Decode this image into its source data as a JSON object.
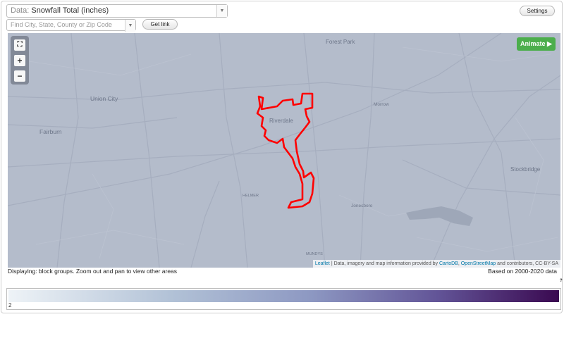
{
  "controls": {
    "data_prefix": "Data:",
    "data_value": "Snowfall Total (inches)",
    "find_placeholder": "Find City, State, County or Zip Code",
    "get_link_label": "Get link",
    "settings_label": "Settings",
    "animate_label": "Animate ▶"
  },
  "map": {
    "zoom_in": "+",
    "zoom_out": "−",
    "labels": {
      "forest_park": "Forest Park",
      "union_city": "Union City",
      "fairburn": "Fairburn",
      "riverdale": "Riverdale",
      "morrow": "Morrow",
      "stockbridge": "Stockbridge",
      "jonesboro": "Jonesboro",
      "helmer": "HELMER",
      "mundys": "MUNDYS"
    },
    "attribution": {
      "leaflet": "Leaflet",
      "text_1": " | Data, imagery and map information provided by ",
      "cartodb": "CartoDB",
      "sep": ", ",
      "osm": "OpenStreetMap",
      "text_2": " and contributors, CC-BY-SA"
    },
    "boundary_color": "#ff0000",
    "base_color": "#b4bccb"
  },
  "captions": {
    "displaying": "Displaying: block groups. Zoom out and pan to view other areas",
    "based_on": "Based on 2000-2020 data"
  },
  "legend": {
    "min": "2",
    "help": "?",
    "colors": [
      "#eef3f7",
      "#b1c1d6",
      "#8d98c2",
      "#625497",
      "#3a0950"
    ]
  }
}
